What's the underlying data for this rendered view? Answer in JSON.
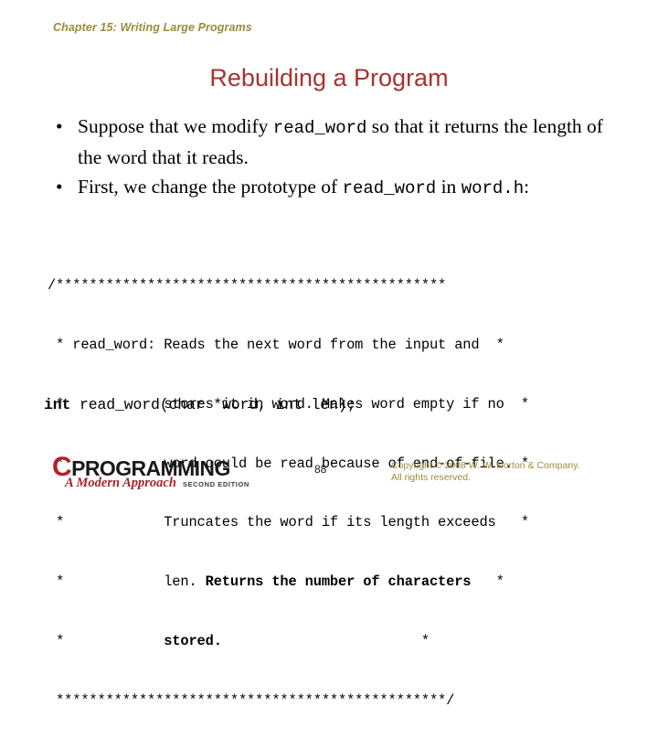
{
  "slide": {
    "chapter_header": "Chapter 15: Writing Large Programs",
    "title": "Rebuilding a Program",
    "page_number": "88"
  },
  "bullets": [
    {
      "marker": "•",
      "part1": "Suppose that we modify ",
      "code1": "read_word",
      "part2": " so that it returns the length of the word that it reads."
    },
    {
      "marker": "•",
      "part1": "First, we change the prototype of ",
      "code1": "read_word",
      "part2": " in ",
      "code2": "word.h",
      "part3": ":"
    }
  ],
  "code": {
    "line_open": "/***********************************************",
    "line1_left": " * read_word: ",
    "line1_text": "Reads the next word from the input and",
    "line1_right": "  *",
    "line2_left": " *            ",
    "line2_text": "stores it in word. Makes word empty if no",
    "line2_right": "  *",
    "line3_left": " *            ",
    "line3_text": "word could be read because of end-of-file.",
    "line3_right": " *",
    "line4_left": " *            ",
    "line4_text": "Truncates the word if its length exceeds",
    "line4_right": "   *",
    "line5_left": " *            ",
    "line5_text_plain": "len. ",
    "line5_text_bold": "Returns the number of characters",
    "line5_right": "   *",
    "line6_left": " *            ",
    "line6_text_bold": "stored.",
    "line6_right": "                        *",
    "line_close": " ***********************************************/",
    "prototype_bold": "int",
    "prototype_rest": " read_word(char *word, int len);"
  },
  "footer": {
    "logo_c": "C",
    "logo_word": "PROGRAMMING",
    "logo_subtitle": "A Modern Approach",
    "logo_edition": "SECOND EDITION",
    "copyright_line1": "Copyright © 2008 W. W. Norton & Company.",
    "copyright_line2": "All rights reserved."
  },
  "colors": {
    "header": "#9b8c3a",
    "title": "#a6332e",
    "logo_red": "#b52025",
    "copyright": "#9b8c3a",
    "body": "#000000",
    "background": "#ffffff"
  }
}
